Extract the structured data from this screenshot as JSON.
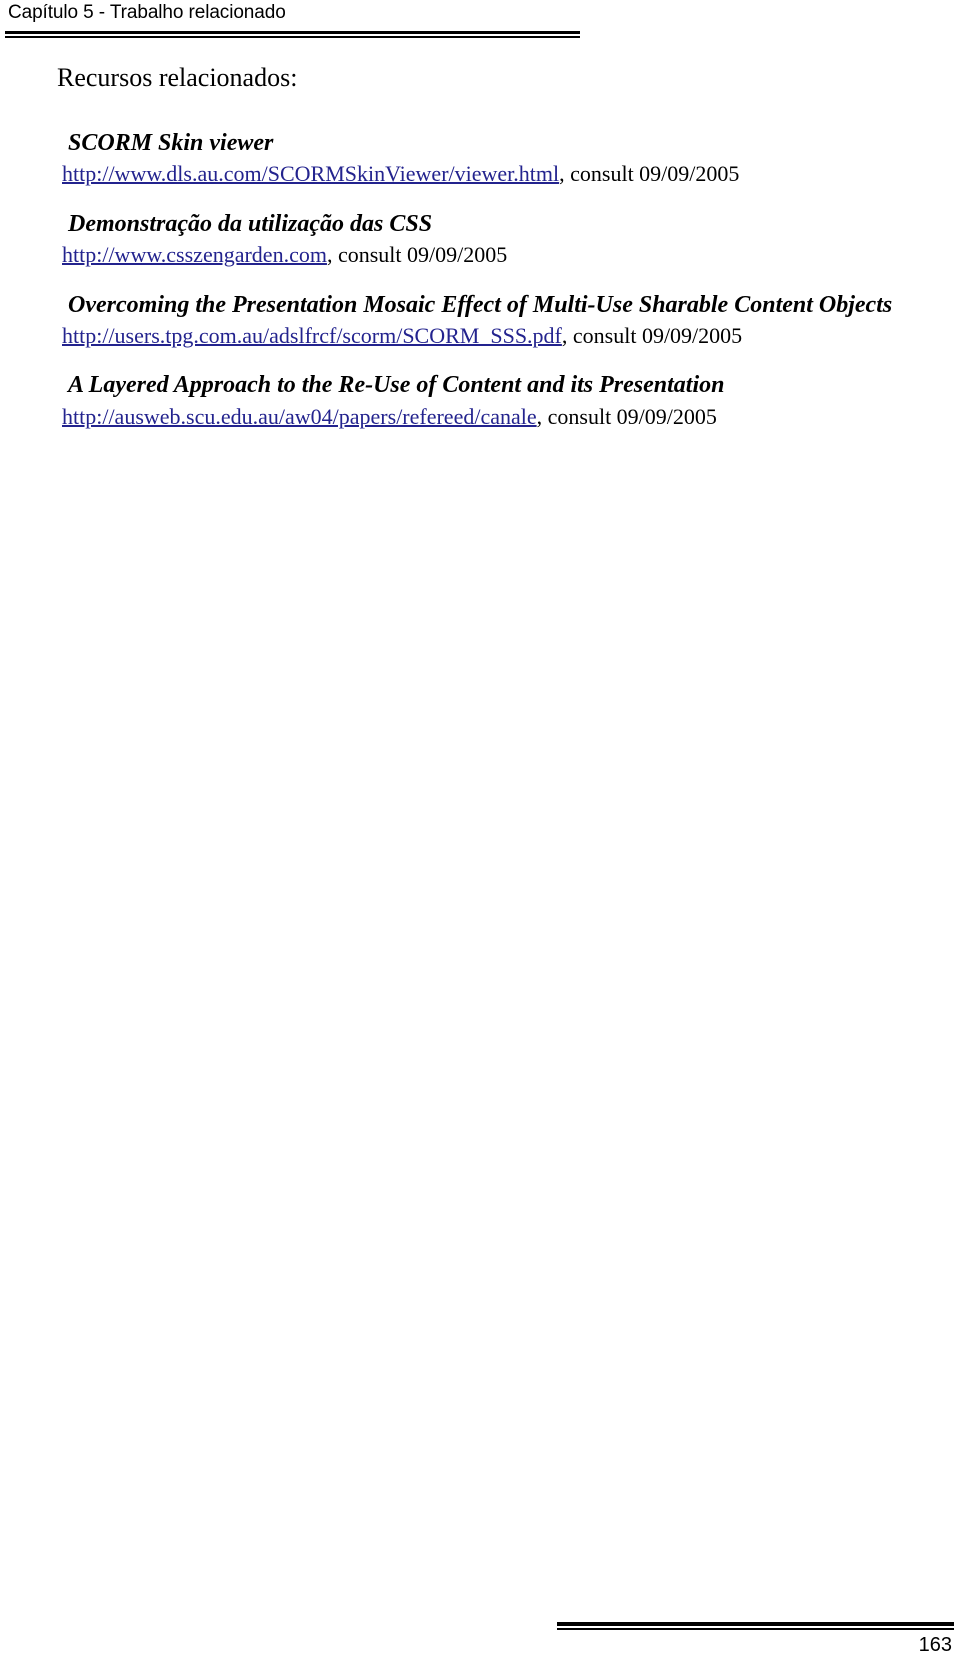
{
  "header": {
    "running_title": "Capítulo 5 - Trabalho relacionado"
  },
  "content": {
    "intro": "Recursos relacionados:",
    "entries": [
      {
        "title": "SCORM Skin viewer",
        "url": "http://www.dls.au.com/SCORMSkinViewer/viewer.html",
        "consulted": ", consult 09/09/2005"
      },
      {
        "title": "Demonstração da utilização das CSS",
        "url": "http://www.csszengarden.com",
        "consulted": ", consult 09/09/2005"
      },
      {
        "title": "Overcoming the Presentation Mosaic Effect of Multi-Use Sharable Content Objects",
        "url": "http://users.tpg.com.au/adslfrcf/scorm/SCORM_SSS.pdf",
        "consulted": ", consult 09/09/2005"
      },
      {
        "title": "A Layered Approach to the Re-Use of Content and its Presentation",
        "url": "http://ausweb.scu.edu.au/aw04/papers/refereed/canale",
        "consulted": ", consult 09/09/2005"
      }
    ]
  },
  "footer": {
    "page_number": "163"
  },
  "colors": {
    "link": "#23238e",
    "text": "#000000",
    "page_background": "#ffffff"
  }
}
